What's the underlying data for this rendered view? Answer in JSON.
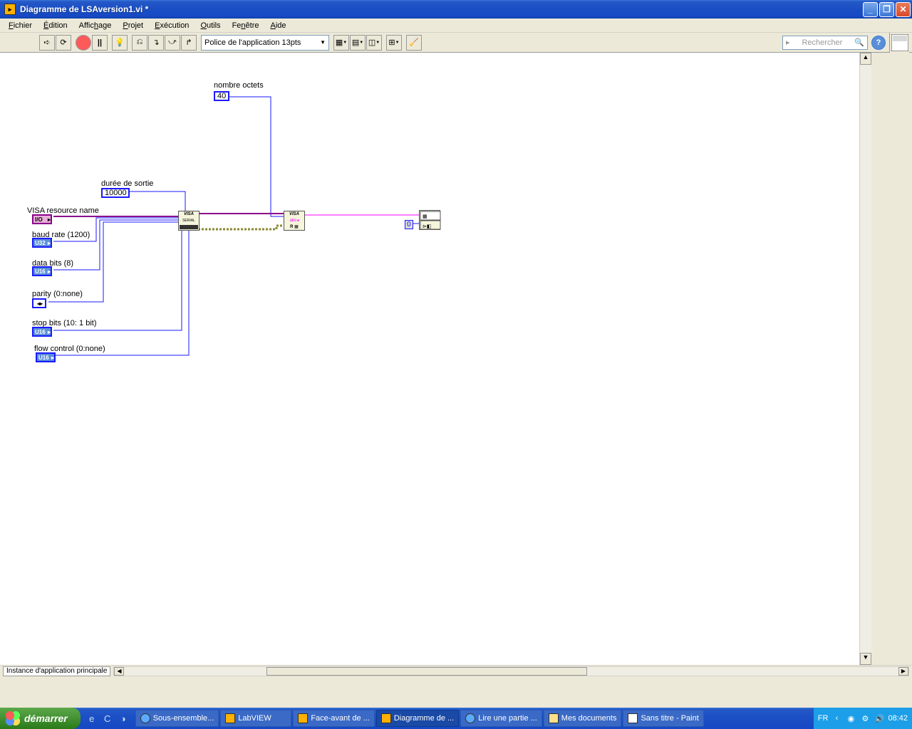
{
  "window": {
    "title": "Diagramme de LSAversion1.vi *"
  },
  "menu": {
    "items": [
      "Fichier",
      "Édition",
      "Affichage",
      "Projet",
      "Exécution",
      "Outils",
      "Fenêtre",
      "Aide"
    ]
  },
  "toolbar": {
    "font": "Police de l'application 13pts",
    "search_placeholder": "Rechercher"
  },
  "diagram": {
    "nombre_octets": {
      "label": "nombre octets",
      "value": "40"
    },
    "duree_sortie": {
      "label": "durée de sortie",
      "value": "10000"
    },
    "visa_resource": {
      "label": "VISA resource name",
      "term": "I/O"
    },
    "baud_rate": {
      "label": "baud rate (1200)",
      "term": "U32"
    },
    "data_bits": {
      "label": "data bits (8)",
      "term": "U16"
    },
    "parity": {
      "label": "parity (0:none)",
      "term": "◂▸"
    },
    "stop_bits": {
      "label": "stop bits (10: 1 bit)",
      "term": "U16"
    },
    "flow_control": {
      "label": "flow control (0:none)",
      "term": "U16"
    },
    "visa_serial": "VISA",
    "visa_read": "VISA",
    "const_zero": "0"
  },
  "status": {
    "instance": "Instance d'application principale"
  },
  "taskbar": {
    "start": "démarrer",
    "tasks": [
      "Sous-ensemble...",
      "LabVIEW",
      "Face-avant de ...",
      "Diagramme de ...",
      "Lire une partie ...",
      "Mes documents",
      "Sans titre - Paint"
    ],
    "lang": "FR",
    "time": "08:42"
  }
}
